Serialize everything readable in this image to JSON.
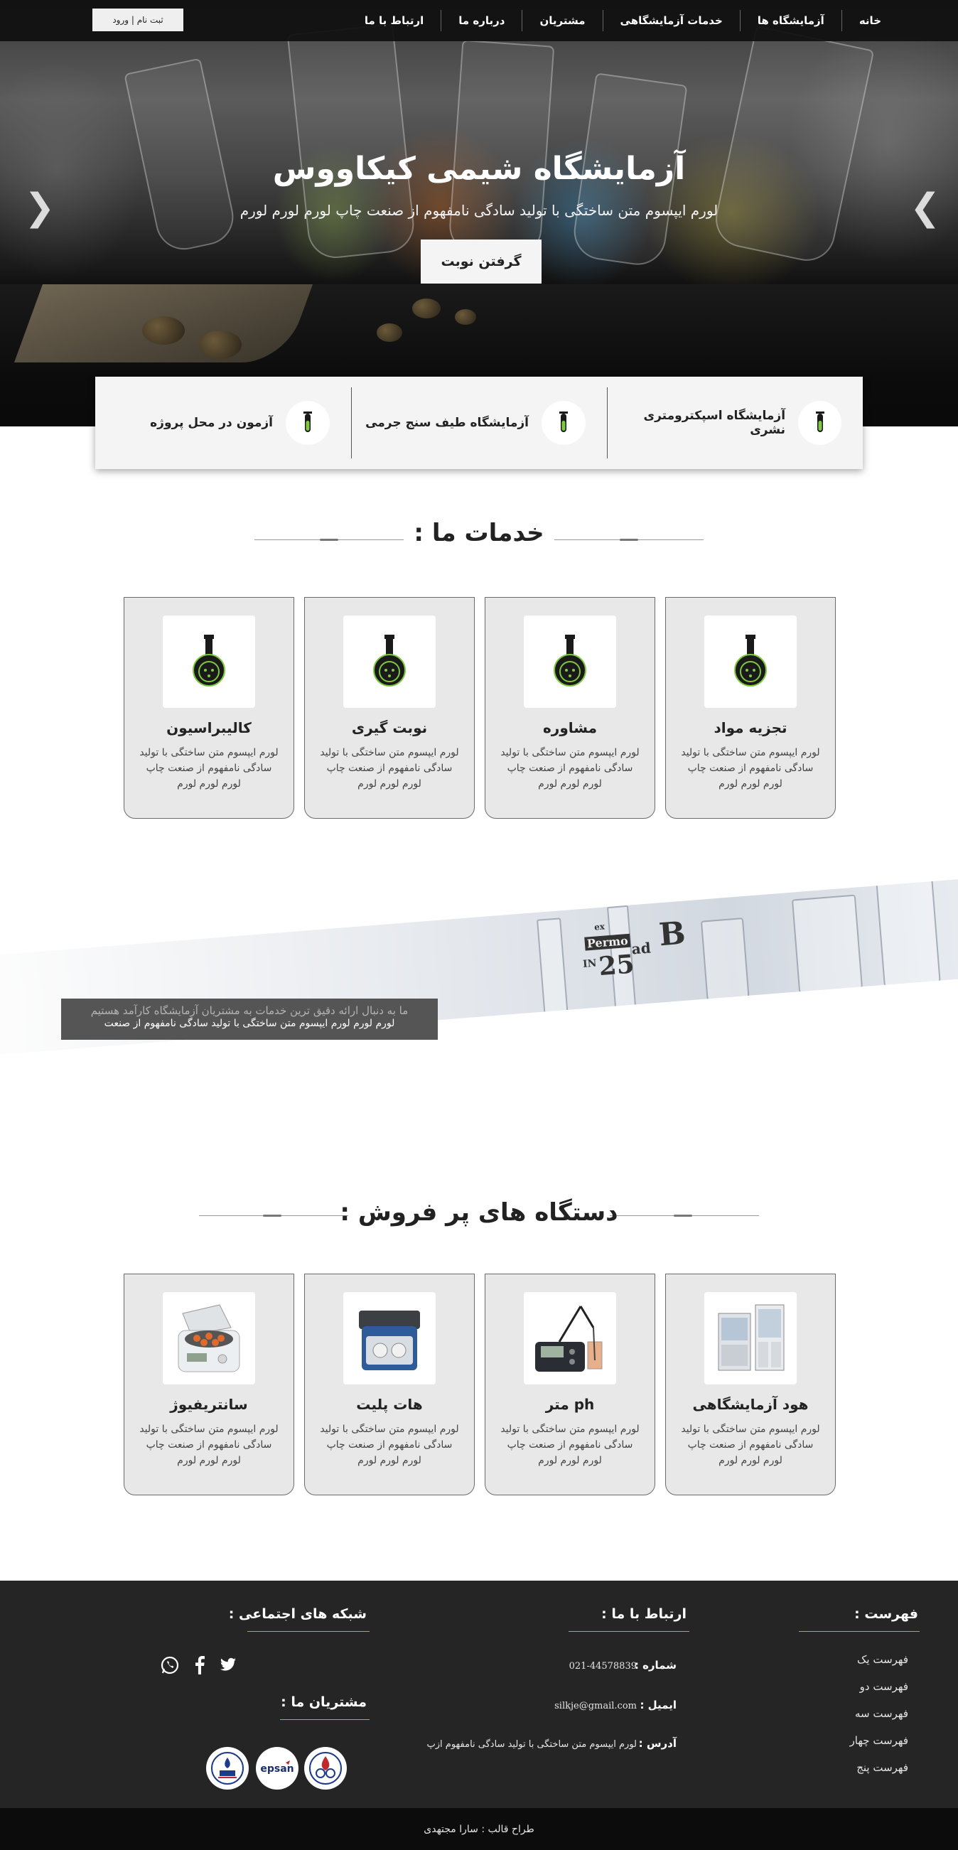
{
  "navbar": {
    "items": [
      {
        "label": "خانه"
      },
      {
        "label": "آزمایشگاه ها"
      },
      {
        "label": "خدمات آزمایشگاهی"
      },
      {
        "label": "مشتریان"
      },
      {
        "label": "درباره ما"
      },
      {
        "label": "ارتباط با ما"
      }
    ],
    "login_label": "ثبت نام | ورود"
  },
  "hero": {
    "title": "آزمایشگاه شیمی کیکاووس",
    "subtitle": "لورم ایپسوم متن ساختگی با تولید سادگی نامفهوم از صنعت چاپ لورم لورم لورم",
    "button_label": "گرفتن نوبت",
    "prev_icon": "chevron-left-icon",
    "next_icon": "chevron-right-icon"
  },
  "labs": [
    {
      "label": "آزمایشگاه اسپکترومتری نشری",
      "icon": "test-tube-icon"
    },
    {
      "label": "آزمایشگاه طیف سنج جرمی",
      "icon": "test-tube-icon"
    },
    {
      "label": "آزمون در محل پروژه",
      "icon": "test-tube-icon"
    }
  ],
  "services": {
    "title": "خدمات ما :",
    "items": [
      {
        "title": "تجزیه مواد",
        "text": "لورم ایپسوم متن ساختگی با تولید سادگی نامفهوم از صنعت چاپ لورم لورم لورم",
        "icon": "flask-icon"
      },
      {
        "title": "مشاوره",
        "text": "لورم ایپسوم متن ساختگی با تولید سادگی نامفهوم از صنعت چاپ لورم لورم لورم",
        "icon": "flask-icon"
      },
      {
        "title": "نوبت گیری",
        "text": "لورم ایپسوم متن ساختگی با تولید سادگی نامفهوم از صنعت چاپ لورم لورم لورم",
        "icon": "flask-icon"
      },
      {
        "title": "کالیبراسیون",
        "text": "لورم ایپسوم متن ساختگی با تولید سادگی نامفهوم از صنعت چاپ لورم لورم لورم",
        "icon": "flask-icon"
      }
    ]
  },
  "banner": {
    "ghost_text": "ما به دنبال ارائه دقیق ترین خدمات به مشتریان آزمایشگاه کارآمد هستیم",
    "text": "لورم لورم لورم ایپسوم متن ساختگی با تولید سادگی نامفهوم از صنعت",
    "photo_labels": {
      "brand": "Permo",
      "number": "25",
      "letter": "B",
      "unit": "IN",
      "line1": "ad",
      "line2": "ex"
    }
  },
  "products": {
    "title": "دستگاه های پر فروش :",
    "items": [
      {
        "title": "هود آزمایشگاهی",
        "text": "لورم ایپسوم متن ساختگی با تولید سادگی نامفهوم از صنعت چاپ لورم لورم لورم",
        "icon": "fume-hood-icon"
      },
      {
        "title": "ph متر",
        "text": "لورم ایپسوم متن ساختگی با تولید سادگی نامفهوم از صنعت چاپ لورم لورم لورم",
        "icon": "ph-meter-icon"
      },
      {
        "title": "هات پلیت",
        "text": "لورم ایپسوم متن ساختگی با تولید سادگی نامفهوم از صنعت چاپ لورم لورم لورم",
        "icon": "hot-plate-icon"
      },
      {
        "title": "سانتریفیوژ",
        "text": "لورم ایپسوم متن ساختگی با تولید سادگی نامفهوم از صنعت چاپ لورم لورم لورم",
        "icon": "centrifuge-icon"
      }
    ]
  },
  "footer": {
    "menu_title": "فهرست :",
    "menu_items": [
      "فهرست یک",
      "فهرست دو",
      "فهرست سه",
      "فهرست چهار",
      "فهرست پنج"
    ],
    "contact_title": "ارتباط با ما :",
    "phone_label": "شماره :",
    "phone_value": "021-44578839",
    "email_label": "ایمیل :",
    "email_value": "silkje@gmail.com",
    "address_label": "آدرس :",
    "address_value": "لورم ایپسوم متن ساختگی با تولید سادگی نامفهوم ازپ",
    "social_title": "شبکه های اجتماعی :",
    "social_icons": [
      "twitter-icon",
      "facebook-icon",
      "whatsapp-icon"
    ],
    "clients_title": "مشتریان ما :",
    "clients": [
      {
        "icon": "refinery-logo-icon"
      },
      {
        "icon": "epsan-logo-icon",
        "brand": "epsan"
      },
      {
        "icon": "oil-company-logo-icon"
      }
    ],
    "credit": "طراح قالب : سارا مجتهدی"
  },
  "colors": {
    "accent": "#c89b3c",
    "nav_bg": "#0f0f0f",
    "footer_bg": "#252525",
    "card_bg": "#e8e8e8",
    "icon_green": "#7ec840"
  }
}
